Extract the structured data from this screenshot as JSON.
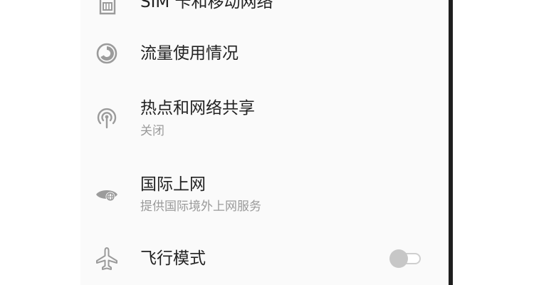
{
  "settings": {
    "items": [
      {
        "title": "SIM 卡和移动网络",
        "icon": "sim-card-icon"
      },
      {
        "title": "流量使用情况",
        "icon": "data-usage-icon"
      },
      {
        "title": "热点和网络共享",
        "subtitle": "关闭",
        "icon": "hotspot-icon"
      },
      {
        "title": "国际上网",
        "subtitle": "提供国际境外上网服务",
        "icon": "global-roaming-icon"
      },
      {
        "title": "飞行模式",
        "icon": "airplane-icon",
        "toggle": "off"
      }
    ]
  },
  "colors": {
    "panel_background": "#fafafa",
    "title_text": "#222222",
    "subtitle_text": "#9a9a9a",
    "icon_gray": "#9b9b9b"
  }
}
